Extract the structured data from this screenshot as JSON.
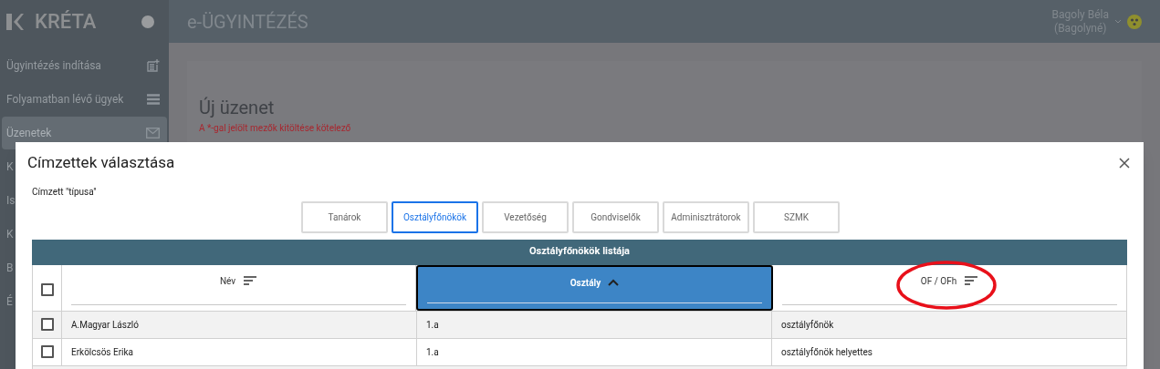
{
  "app": {
    "logo": "KRÉTA",
    "title": "e-ÜGYINTÉZÉS",
    "user": {
      "name": "Bagoly Béla",
      "alias": "(Bagolyné)"
    }
  },
  "sidebar": {
    "items": [
      {
        "label": "Ügyintézés indítása",
        "kind": "create",
        "selected": false
      },
      {
        "label": "Folyamatban lévő ügyek",
        "kind": "list",
        "selected": false
      },
      {
        "label": "Üzenetek",
        "kind": "mail",
        "selected": true
      },
      {
        "label": "K",
        "kind": "plain",
        "selected": false
      },
      {
        "label": "Is",
        "kind": "plain",
        "selected": false
      },
      {
        "label": "K",
        "kind": "plain",
        "selected": false
      },
      {
        "label": "B",
        "kind": "plain",
        "selected": false
      },
      {
        "label": "É",
        "kind": "plain",
        "selected": false
      }
    ]
  },
  "page": {
    "heading": "Új üzenet",
    "note": "A *-gal jelölt mezők kitöltése kötelező"
  },
  "dialog": {
    "title": "Címzettek választása",
    "type_label": "Címzett \"típusa\"",
    "tabs": [
      {
        "label": "Tanárok",
        "selected": false
      },
      {
        "label": "Osztályfőnökök",
        "selected": true
      },
      {
        "label": "Vezetőség",
        "selected": false
      },
      {
        "label": "Gondviselők",
        "selected": false
      },
      {
        "label": "Adminisztrátorok",
        "selected": false
      },
      {
        "label": "SZMK",
        "selected": false
      }
    ],
    "table": {
      "title": "Osztályfőnökök listája",
      "select_all": {
        "checked": false
      },
      "columns": [
        {
          "label": "Név",
          "sorted": false,
          "selected": false,
          "annotated": false
        },
        {
          "label": "Osztály",
          "sorted": true,
          "selected": true,
          "annotated": false
        },
        {
          "label": "OF / OFh",
          "sorted": false,
          "selected": false,
          "annotated": true
        }
      ],
      "rows": [
        {
          "checked": false,
          "cells": [
            "A.Magyar László",
            "1.a",
            "osztályfőnök"
          ]
        },
        {
          "checked": false,
          "cells": [
            "Erkölcsös Erika",
            "1.a",
            "osztályfőnök helyettes"
          ]
        }
      ]
    }
  }
}
